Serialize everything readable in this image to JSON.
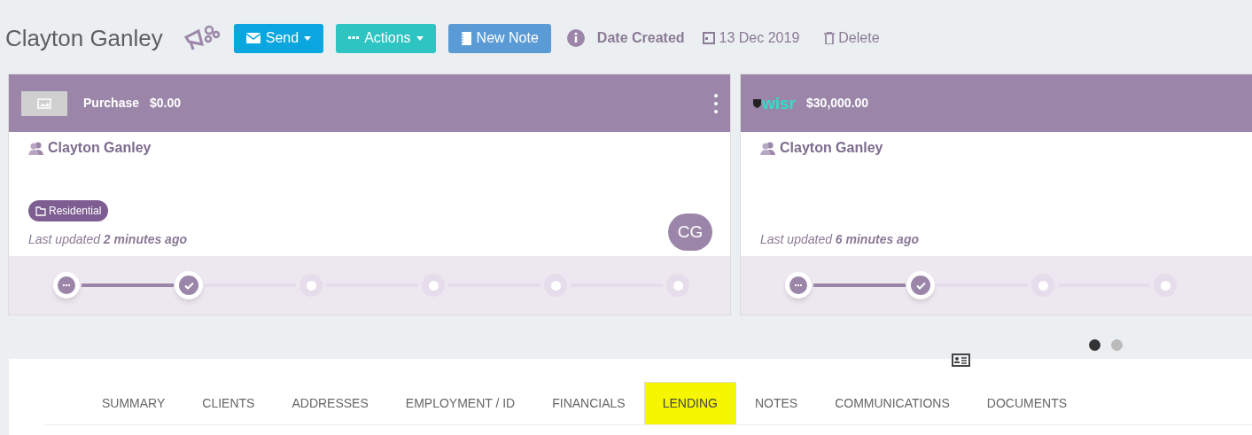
{
  "header": {
    "title": "Clayton Ganley",
    "buttons": [
      {
        "kind": "send",
        "label": "Send",
        "dropdown": true
      },
      {
        "kind": "actions",
        "label": "Actions",
        "dropdown": true
      },
      {
        "kind": "note",
        "label": "New Note",
        "dropdown": false
      }
    ],
    "date_label": "Date Created",
    "date": "13 Dec 2019",
    "delete": "Delete"
  },
  "cards": [
    {
      "kind": "image_logo",
      "title": "Purchase",
      "amount": "$0.00",
      "menu": true,
      "client": "Clayton Ganley",
      "tag": "Residential",
      "updated_prefix": "Last updated",
      "updated_time": "2 minutes ago",
      "avatar": "CG",
      "steps": [
        {
          "kind": "in_progress"
        },
        {
          "kind": "complete"
        },
        {
          "kind": "pending"
        },
        {
          "kind": "pending"
        },
        {
          "kind": "pending"
        },
        {
          "kind": "pending"
        }
      ]
    },
    {
      "kind": "lender_logo",
      "lender": "wisr",
      "amount": "$30,000.00",
      "menu": false,
      "client": "Clayton Ganley",
      "updated_prefix": "Last updated",
      "updated_time": "6 minutes ago",
      "steps": [
        {
          "kind": "in_progress"
        },
        {
          "kind": "complete"
        },
        {
          "kind": "pending"
        },
        {
          "kind": "pending"
        }
      ]
    }
  ],
  "carousel": [
    {
      "selected": true
    },
    {
      "selected": false
    }
  ],
  "tabs": [
    {
      "label": "SUMMARY",
      "selected": false,
      "highlighted": false
    },
    {
      "label": "CLIENTS",
      "selected": false,
      "highlighted": false
    },
    {
      "label": "ADDRESSES",
      "selected": false,
      "highlighted": false
    },
    {
      "label": "EMPLOYMENT / ID",
      "selected": false,
      "highlighted": false
    },
    {
      "label": "FINANCIALS",
      "selected": false,
      "highlighted": false
    },
    {
      "label": "LENDING",
      "selected": true,
      "highlighted": true
    },
    {
      "label": "NOTES",
      "selected": false,
      "highlighted": false
    },
    {
      "label": "COMMUNICATIONS",
      "selected": false,
      "highlighted": false
    },
    {
      "label": "DOCUMENTS",
      "selected": false,
      "highlighted": false
    }
  ]
}
